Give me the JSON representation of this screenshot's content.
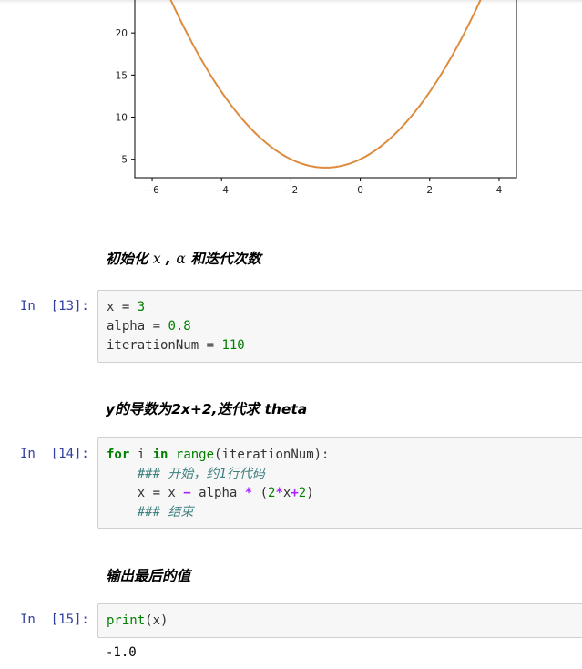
{
  "chart_data": {
    "type": "line",
    "series": [
      {
        "function": "(x+1)^2 + 4",
        "x_range": [
          -6,
          4
        ],
        "color": "#dd8c3e"
      }
    ],
    "xticks": [
      "−6",
      "−4",
      "−2",
      "0",
      "2",
      "4"
    ],
    "yticks": [
      "5",
      "10",
      "15",
      "20"
    ],
    "xlim": [
      -6.5,
      4.5
    ],
    "ylim": [
      2.8,
      25
    ],
    "grid": false
  },
  "cells": [
    {
      "heading": {
        "text_before": "初始化 ",
        "sym1": "x",
        "sep": " , ",
        "sym2": "α",
        "text_after": " 和迭代次数"
      },
      "prompt": "In  [13]:",
      "code": {
        "l1_var": "x = ",
        "l1_val": "3",
        "l2_var": "alpha = ",
        "l2_val": "0.8",
        "l3_var": "iterationNum = ",
        "l3_val": "110"
      }
    },
    {
      "heading": {
        "text": "y的导数为2x+2,迭代求 theta"
      },
      "prompt": "In  [14]:",
      "code": {
        "for": "for",
        "i": " i ",
        "in": "in",
        "sp": " ",
        "range": "range",
        "range_arg": "(iterationNum):",
        "c1": "    ### 开始，约1行代码",
        "asg_pre": "    x = x ",
        "minus": "−",
        "alpha": " alpha ",
        "mul": "*",
        "paren_open": " (",
        "two": "2",
        "mul2": "*",
        "xv": "x",
        "plus": "+",
        "two2": "2",
        "paren_close": ")",
        "c2": "    ### 结束"
      }
    },
    {
      "heading": {
        "text": "输出最后的值"
      },
      "prompt": "In  [15]:",
      "code": {
        "print": "print",
        "arg": "(x)"
      },
      "output": "-1.0"
    }
  ]
}
